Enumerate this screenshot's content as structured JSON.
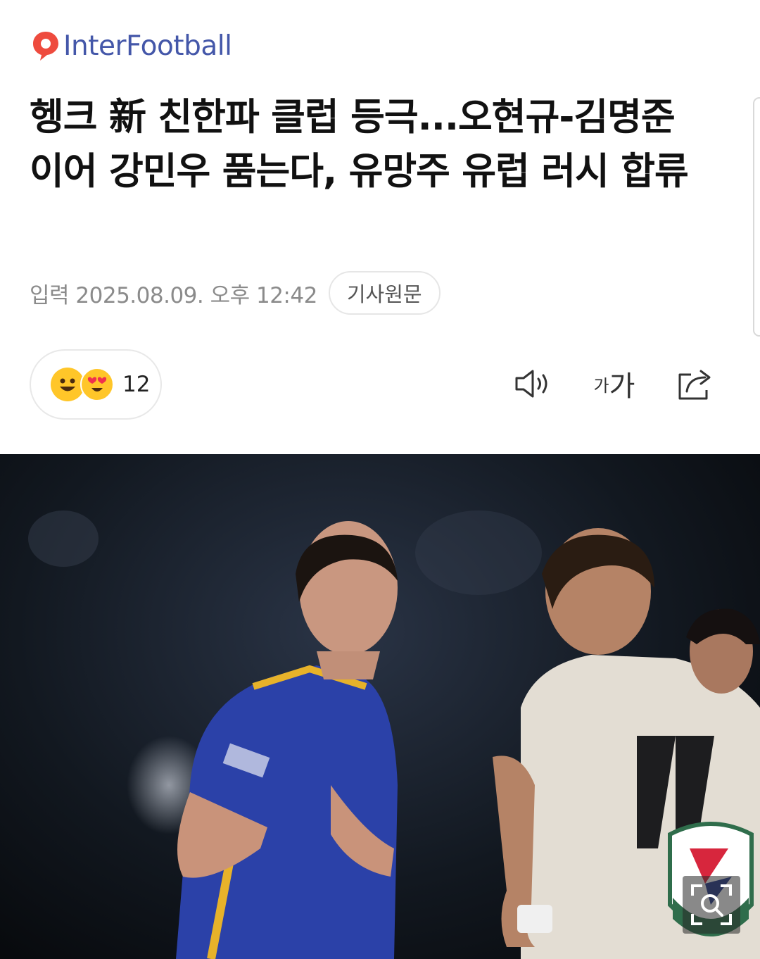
{
  "brand": {
    "name": "InterFootball"
  },
  "article": {
    "headline": "헹크 新 친한파 클럽 등극...오현규-김명준 이어 강민우 품는다, 유망주 유럽 러시 합류",
    "date_label": "입력 2025.08.09. 오후 12:42",
    "source_button": "기사원문"
  },
  "reactions": {
    "count": "12"
  },
  "toolbar": {
    "font_small": "가",
    "font_large": "가"
  },
  "colors": {
    "brand_red": "#ee4b3e",
    "brand_blue": "#4457a9"
  }
}
